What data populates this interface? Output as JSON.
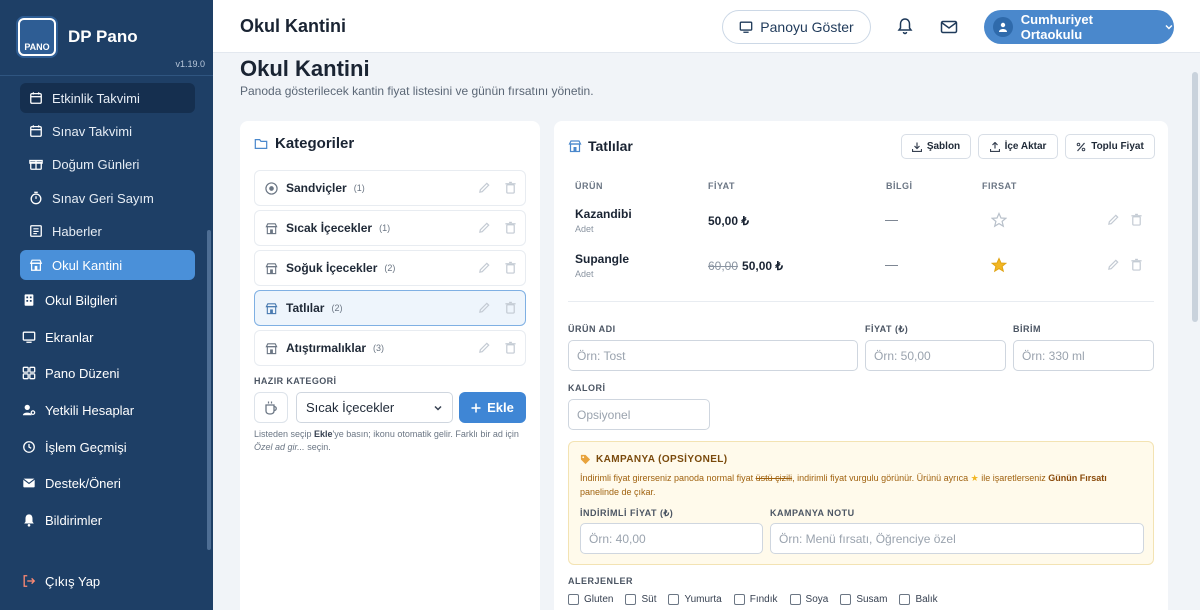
{
  "brand": {
    "name": "DP Pano",
    "logo_text": "PANO",
    "version": "v1.19.0"
  },
  "sidebar": {
    "sub_items": [
      {
        "label": "Etkinlik Takvimi",
        "icon": "calendar-icon",
        "state": "dark"
      },
      {
        "label": "Sınav Takvimi",
        "icon": "calendar-icon",
        "state": "normal"
      },
      {
        "label": "Doğum Günleri",
        "icon": "gift-icon",
        "state": "normal"
      },
      {
        "label": "Sınav Geri Sayım",
        "icon": "stopwatch-icon",
        "state": "normal"
      },
      {
        "label": "Haberler",
        "icon": "newspaper-icon",
        "state": "normal"
      },
      {
        "label": "Okul Kantini",
        "icon": "store-icon",
        "state": "active"
      }
    ],
    "main_items": [
      {
        "label": "Okul Bilgileri",
        "icon": "building-icon"
      },
      {
        "label": "Ekranlar",
        "icon": "monitor-icon"
      },
      {
        "label": "Pano Düzeni",
        "icon": "layout-icon"
      },
      {
        "label": "Yetkili Hesaplar",
        "icon": "users-cog-icon"
      },
      {
        "label": "İşlem Geçmişi",
        "icon": "history-icon"
      },
      {
        "label": "Destek/Öneri",
        "icon": "envelope-icon"
      },
      {
        "label": "Bildirimler",
        "icon": "bell-icon"
      }
    ],
    "logout": "Çıkış Yap"
  },
  "topbar": {
    "title": "Okul Kantini",
    "pano_button": "Panoyu Göster",
    "user": "Cumhuriyet Ortaokulu"
  },
  "page": {
    "title": "Okul Kantini",
    "subtitle": "Panoda gösterilecek kantin fiyat listesini ve günün fırsatını yönetin."
  },
  "categories": {
    "title": "Kategoriler",
    "items": [
      {
        "name": "Sandviçler",
        "count": "(1)",
        "icon": "sandwich-icon",
        "selected": false
      },
      {
        "name": "Sıcak İçecekler",
        "count": "(1)",
        "icon": "store-icon",
        "selected": false
      },
      {
        "name": "Soğuk İçecekler",
        "count": "(2)",
        "icon": "store-icon",
        "selected": false
      },
      {
        "name": "Tatlılar",
        "count": "(2)",
        "icon": "store-icon",
        "selected": true
      },
      {
        "name": "Atıştırmalıklar",
        "count": "(3)",
        "icon": "store-icon",
        "selected": false
      }
    ],
    "hazir_label": "HAZIR KATEGORİ",
    "select_value": "Sıcak İçecekler",
    "add_button": "Ekle",
    "hint_1": "Listeden seçip ",
    "hint_bold": "Ekle",
    "hint_2": "'ye basın; ikonu otomatik gelir. Farklı bir ad için ",
    "hint_italic": "Özel ad gir...",
    "hint_3": " seçin."
  },
  "products": {
    "title": "Tatlılar",
    "buttons": {
      "template": "Şablon",
      "import": "İçe Aktar",
      "bulk_price": "Toplu Fiyat"
    },
    "columns": {
      "product": "ÜRÜN",
      "price": "FİYAT",
      "info": "BİLGİ",
      "deal": "FIRSAT"
    },
    "rows": [
      {
        "name": "Kazandibi",
        "unit": "Adet",
        "old_price": "",
        "price": "50,00 ₺",
        "info": "—",
        "featured": false
      },
      {
        "name": "Supangle",
        "unit": "Adet",
        "old_price": "60,00",
        "price": "50,00 ₺",
        "info": "—",
        "featured": true
      }
    ],
    "form": {
      "name_label": "ÜRÜN ADI",
      "name_placeholder": "Örn: Tost",
      "price_label": "FİYAT (₺)",
      "price_placeholder": "Örn: 50,00",
      "unit_label": "BİRİM",
      "unit_placeholder": "Örn: 330 ml",
      "calorie_label": "KALORİ",
      "calorie_placeholder": "Opsiyonel"
    },
    "campaign": {
      "title": "KAMPANYA (OPSİYONEL)",
      "desc_1": "İndirimli fiyat girerseniz panoda normal fiyat ",
      "desc_strike": "üstü çizili",
      "desc_2": ", indirimli fiyat vurgulu görünür. Ürünü ayrıca ",
      "desc_3": " ile işaretlerseniz ",
      "desc_bold": "Günün Fırsatı",
      "desc_4": " panelinde de çıkar.",
      "discount_label": "İNDİRİMLİ FİYAT (₺)",
      "discount_placeholder": "Örn: 40,00",
      "note_label": "KAMPANYA NOTU",
      "note_placeholder": "Örn: Menü fırsatı, Öğrenciye özel"
    },
    "allergens_label": "ALERJENLER",
    "allergens": [
      "Gluten",
      "Süt",
      "Yumurta",
      "Fındık",
      "Soya",
      "Susam",
      "Balık"
    ]
  },
  "colors": {
    "sidebar": "#1e3f66",
    "accent": "#4a90d9",
    "star": "#f2b623"
  }
}
